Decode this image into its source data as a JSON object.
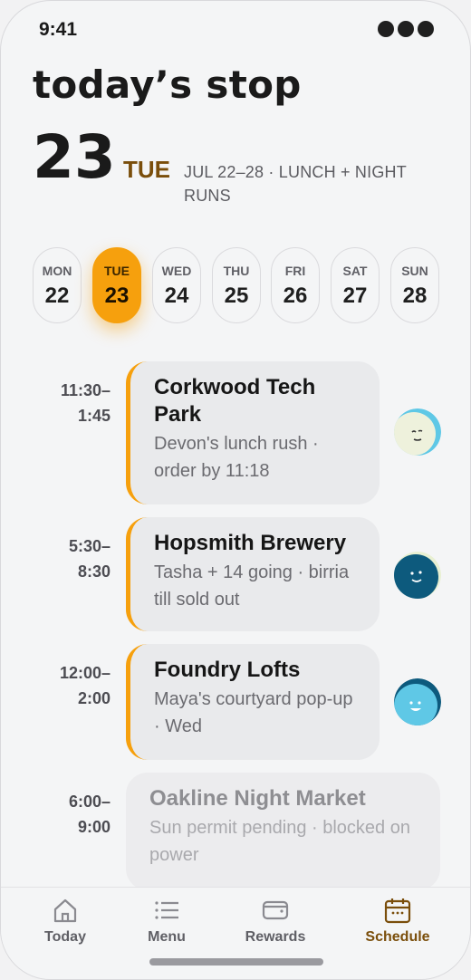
{
  "status": {
    "time": "9:41"
  },
  "header": {
    "title": "today’s stop",
    "day_number": "23",
    "day_of_week": "TUE",
    "week_info": "JUL 22–28 · LUNCH + NIGHT RUNS"
  },
  "week": [
    {
      "dow": "MON",
      "num": "22"
    },
    {
      "dow": "TUE",
      "num": "23",
      "active": true
    },
    {
      "dow": "WED",
      "num": "24"
    },
    {
      "dow": "THU",
      "num": "25"
    },
    {
      "dow": "FRI",
      "num": "26"
    },
    {
      "dow": "SAT",
      "num": "27"
    },
    {
      "dow": "SUN",
      "num": "28"
    }
  ],
  "stops": [
    {
      "time_start": "11:30–",
      "time_end": "1:45",
      "name": "Corkwood Tech Park",
      "detail": "Devon's lunch rush · order by 11:18"
    },
    {
      "time_start": "5:30–",
      "time_end": "8:30",
      "name": "Hopsmith Brewery",
      "detail": "Tasha + 14 going · birria till sold out"
    },
    {
      "time_start": "12:00–",
      "time_end": "2:00",
      "name": "Foundry Lofts",
      "detail": "Maya's courtyard pop-up · Wed"
    },
    {
      "time_start": "6:00–",
      "time_end": "9:00",
      "name": "Oakline Night Market",
      "detail": "Sun permit pending · blocked on power"
    }
  ],
  "tabs": [
    {
      "label": "Today",
      "icon": "home-icon"
    },
    {
      "label": "Menu",
      "icon": "menu-list-icon"
    },
    {
      "label": "Rewards",
      "icon": "wallet-icon"
    },
    {
      "label": "Schedule",
      "icon": "calendar-icon",
      "active": true
    }
  ],
  "colors": {
    "accent": "#f6a00d",
    "accent_text": "#7a4e0b",
    "card": "#e9eaec"
  }
}
